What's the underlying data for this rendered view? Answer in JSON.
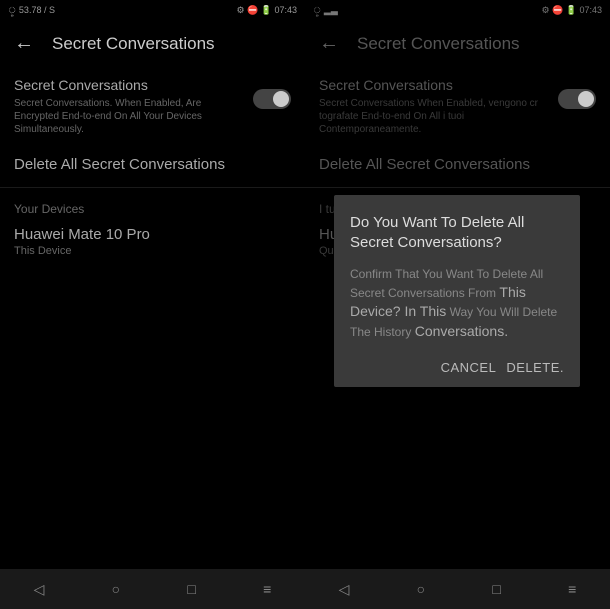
{
  "left": {
    "status": {
      "left": "ৢ 53.78 / S",
      "right": "⚙ ⛔ 🔋 07:43"
    },
    "header": {
      "title": "Secret Conversations"
    },
    "setting": {
      "title": "Secret Conversations",
      "desc": "Secret Conversations. When Enabled, Are Encrypted End-to-end On All Your Devices Simultaneously."
    },
    "delete_all": "Delete All Secret Conversations",
    "section": "Your Devices",
    "device": {
      "name": "Huawei Mate 10 Pro",
      "sub": "This Device"
    }
  },
  "right": {
    "status": {
      "left": "ৢ ▂▃",
      "right": "⚙ ⛔ 🔋 07:43"
    },
    "header": {
      "title": "Secret Conversations"
    },
    "setting": {
      "title": "Secret Conversations",
      "desc": "Secret Conversations When Enabled, vengono cr tografate End-to-end On All i tuoi Contemporaneamente."
    },
    "delete_all": "Delete All Secret Conversations",
    "section": "I tu",
    "device": {
      "name": "Hu",
      "sub": "Qu"
    }
  },
  "dialog": {
    "title": "Do You Want To Delete All Secret Conversations?",
    "body1": "Confirm That You Want To Delete All Secret Conversations From",
    "body2": "This Device? In This",
    "body3": "Way You Will Delete The History",
    "body4": "Conversations.",
    "cancel": "CANCEL",
    "delete": "DELETE."
  },
  "nav": {
    "back": "◁",
    "home": "○",
    "recent": "□",
    "menu": "≡"
  }
}
